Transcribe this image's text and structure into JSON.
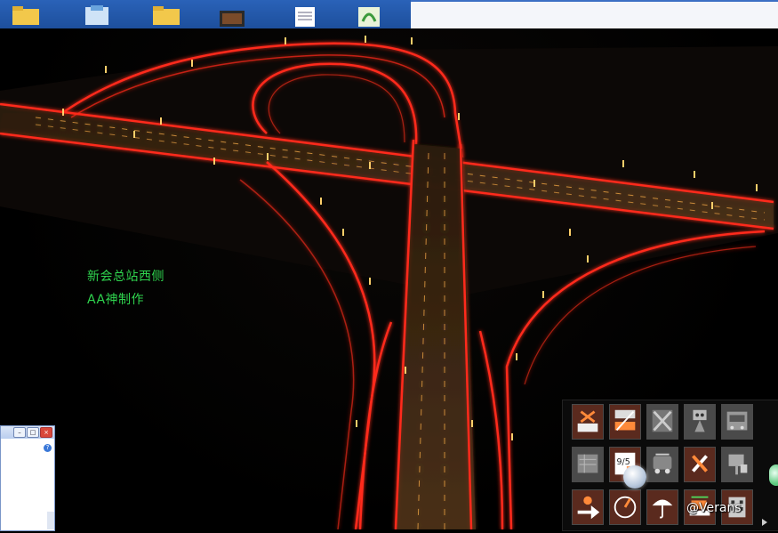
{
  "overlay": {
    "line1": "新会总站西侧",
    "line2": "AA神制作"
  },
  "watermark": {
    "text": "@Verans"
  },
  "mini_window": {
    "minimize_label": "–",
    "maximize_label": "□",
    "close_label": "×",
    "help_label": "?"
  },
  "toolbar": {
    "rows": 3,
    "cols": 5,
    "buttons": [
      {
        "icon": "junction-tool-icon",
        "state": "active"
      },
      {
        "icon": "road-layer-icon",
        "state": "active"
      },
      {
        "icon": "broken-road-icon",
        "state": "inactive"
      },
      {
        "icon": "traffic-signal-icon",
        "state": "inactive"
      },
      {
        "icon": "vehicle-depot-icon",
        "state": "inactive"
      },
      {
        "icon": "map-sheet-icon",
        "state": "inactive"
      },
      {
        "icon": "timetable-icon",
        "state": "active"
      },
      {
        "icon": "bus-icon",
        "state": "inactive"
      },
      {
        "icon": "repair-tools-icon",
        "state": "active"
      },
      {
        "icon": "road-sign-icon",
        "state": "inactive"
      },
      {
        "icon": "route-arrow-icon",
        "state": "active"
      },
      {
        "icon": "speedometer-icon",
        "state": "active"
      },
      {
        "icon": "weather-umbrella-icon",
        "state": "active"
      },
      {
        "icon": "bulldozer-icon",
        "state": "active"
      },
      {
        "icon": "city-building-icon",
        "state": "active"
      }
    ]
  },
  "colors": {
    "road_glow": "#ff2a1a",
    "road_light": "#ffb04a",
    "overlay_text": "#2fd34e",
    "tool_active_bg": "#5a2a1e",
    "tool_inactive_bg": "#4a4a4a"
  }
}
